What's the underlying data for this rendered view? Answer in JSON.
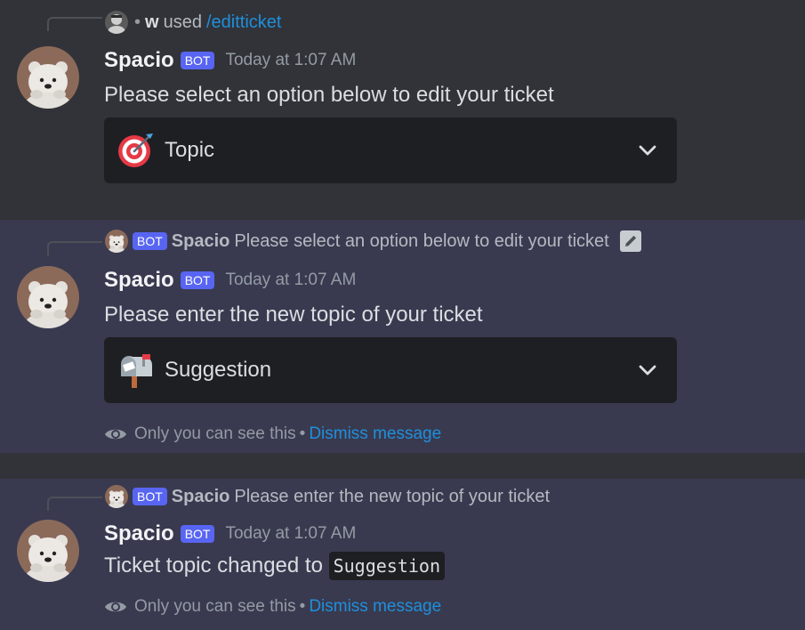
{
  "messages": [
    {
      "reply": {
        "user": "w",
        "verb": "used",
        "command": "/editticket"
      },
      "author": "Spacio",
      "bot_tag": "BOT",
      "timestamp": "Today at 1:07 AM",
      "content": "Please select an option below to edit your ticket",
      "select": {
        "emoji": "direct-hit-emoji",
        "value": "Topic"
      }
    },
    {
      "reply": {
        "bot_tag": "BOT",
        "user": "Spacio",
        "text": "Please select an option below to edit your ticket",
        "icon": "edit-pencil-icon"
      },
      "author": "Spacio",
      "bot_tag": "BOT",
      "timestamp": "Today at 1:07 AM",
      "content": "Please enter the new topic of your ticket",
      "select": {
        "emoji": "mailbox-with-mail-emoji",
        "value": "Suggestion"
      },
      "ephemeral": {
        "note": "Only you can see this",
        "separator": "•",
        "dismiss": "Dismiss message"
      }
    },
    {
      "reply": {
        "bot_tag": "BOT",
        "user": "Spacio",
        "text": "Please enter the new topic of your ticket"
      },
      "author": "Spacio",
      "bot_tag": "BOT",
      "timestamp": "Today at 1:07 AM",
      "content_prefix": "Ticket topic changed to",
      "content_code": "Suggestion",
      "ephemeral": {
        "note": "Only you can see this",
        "separator": "•",
        "dismiss": "Dismiss message"
      }
    }
  ],
  "colors": {
    "background": "#313338",
    "ephemeral_bg": "#393a4f",
    "bot_tag": "#5865f2",
    "link": "#1f8fdc",
    "select_bg": "#1e1f22"
  }
}
